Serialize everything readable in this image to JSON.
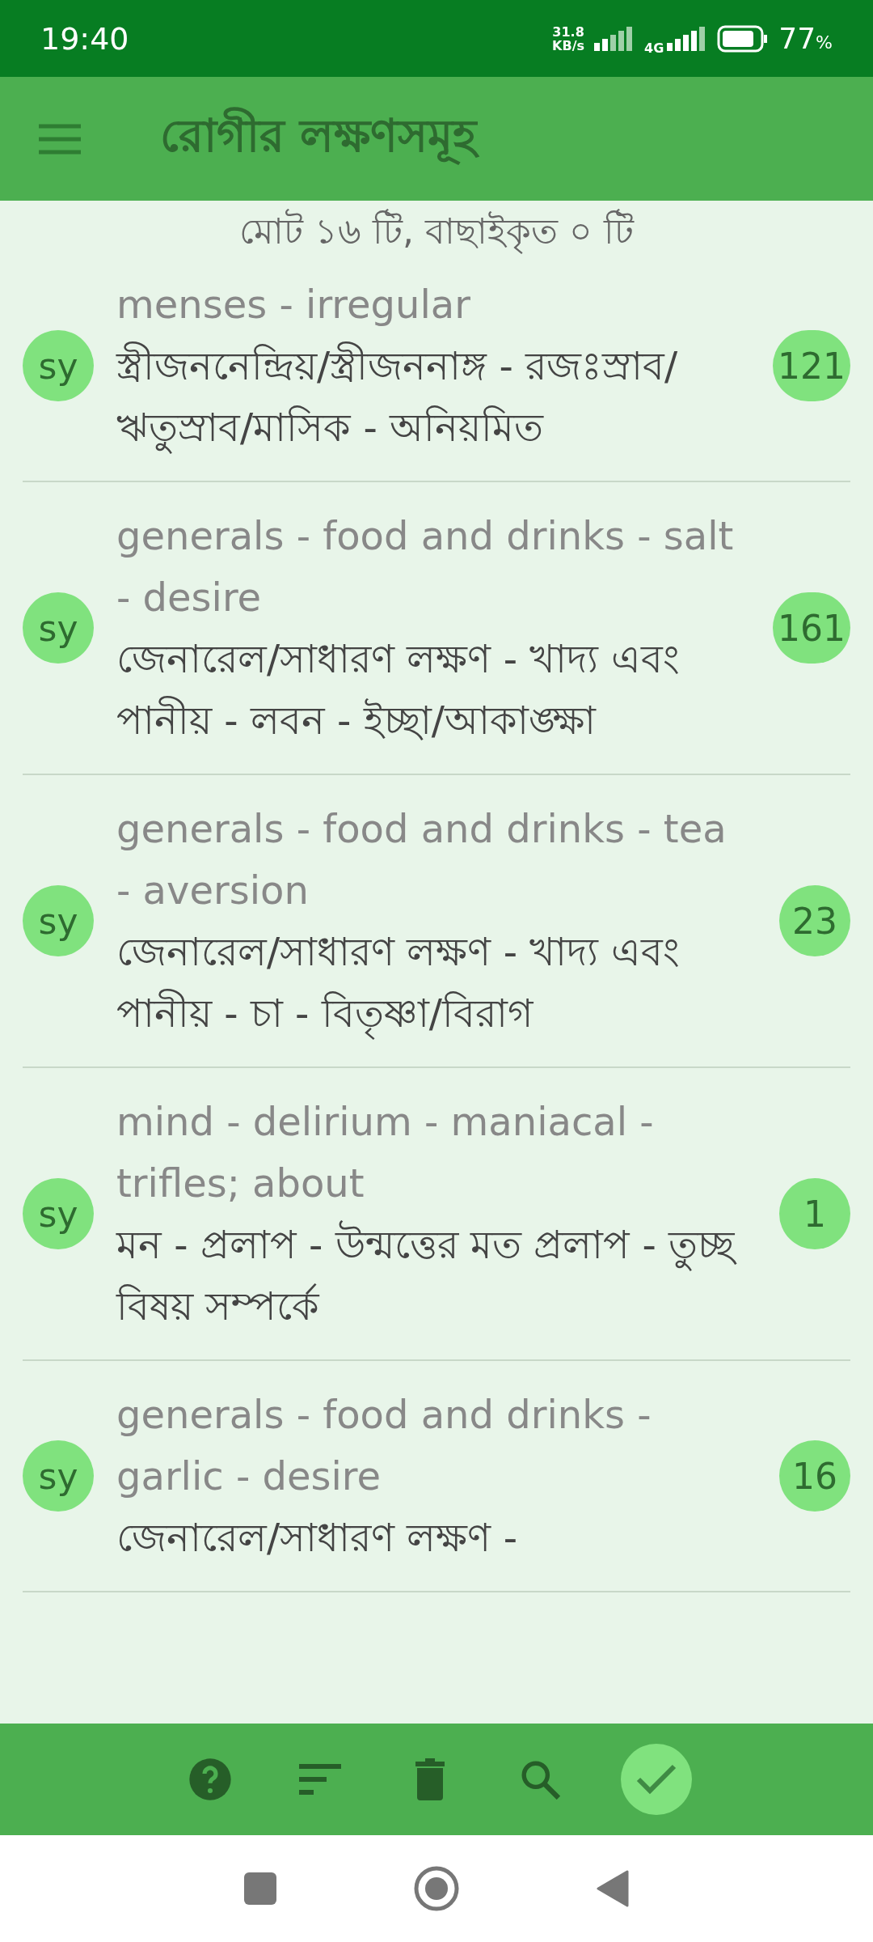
{
  "status_bar": {
    "time": "19:40",
    "net_speed": "31.8",
    "net_unit": "KB/s",
    "network": "4G",
    "battery": "77",
    "battery_unit": "%"
  },
  "app_bar": {
    "title": "রোগীর লক্ষণসমূহ"
  },
  "summary": "মোট ১৬ টি, বাছাইকৃত ০ টি",
  "symptoms": [
    {
      "badge": "sy",
      "english": "menses - irregular",
      "bengali": "স্ত্রীজননেন্দ্রিয়/স্ত্রীজননাঙ্গ - রজঃস্রাব/ঋতুস্রাব/মাসিক - অনিয়মিত",
      "count": "121"
    },
    {
      "badge": "sy",
      "english": "generals - food and drinks - salt - desire",
      "bengali": "জেনারেল/সাধারণ লক্ষণ - খাদ্য এবং পানীয় - লবন - ইচ্ছা/আকাঙ্ক্ষা",
      "count": "161"
    },
    {
      "badge": "sy",
      "english": "generals - food and drinks - tea - aversion",
      "bengali": "জেনারেল/সাধারণ লক্ষণ - খাদ্য এবং পানীয় - চা - বিতৃষ্ণা/বিরাগ",
      "count": "23"
    },
    {
      "badge": "sy",
      "english": "mind - delirium - maniacal - trifles; about",
      "bengali": "মন - প্রলাপ - উন্মত্তের মত প্রলাপ - তুচ্ছ বিষয় সম্পর্কে",
      "count": "1"
    },
    {
      "badge": "sy",
      "english": "generals - food and drinks - garlic - desire",
      "bengali": "জেনারেল/সাধারণ লক্ষণ -",
      "count": "16"
    }
  ],
  "bottom_bar": {
    "actions": [
      {
        "kind": "help"
      },
      {
        "kind": "sort"
      },
      {
        "kind": "delete"
      },
      {
        "kind": "search"
      },
      {
        "kind": "confirm"
      }
    ]
  }
}
